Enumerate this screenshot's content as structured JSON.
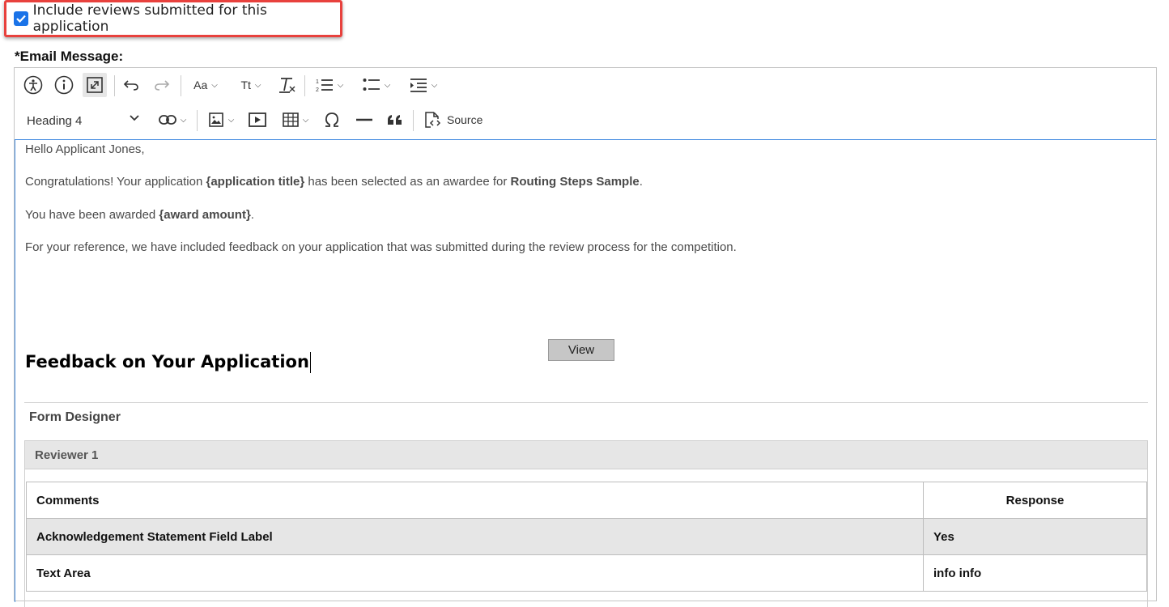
{
  "include": {
    "label": "Include reviews submitted for this application",
    "checked": true
  },
  "email_label": "*Email Message:",
  "toolbar": {
    "row1_icons": [
      "accessibility-icon",
      "info-icon",
      "maximize-icon",
      "undo-icon",
      "redo-icon",
      "font-size-icon",
      "text-case-icon",
      "clear-format-icon",
      "numbered-list-icon",
      "bulleted-list-icon",
      "indent-icon"
    ],
    "font_size_label": "Aa",
    "text_case_label": "Tt",
    "heading_value": "Heading 4",
    "source_label": "Source"
  },
  "content": {
    "greeting": "Hello Applicant Jones,",
    "congrats_pre": "Congratulations! Your application ",
    "congrats_app": "{application title}",
    "congrats_mid": " has been selected as an awardee for ",
    "congrats_comp": "Routing Steps Sample",
    "congrats_end": ".",
    "awarded_pre": "You have been awarded ",
    "awarded_amount": "{award amount}",
    "awarded_end": ".",
    "reference": "For your reference, we have included feedback on your application that was submitted during the review process for the competition.",
    "view_button": "View",
    "feedback_title": "Feedback on Your Application",
    "form_designer": "Form Designer",
    "reviewer": "Reviewer 1",
    "table": {
      "headers": [
        "Comments",
        "Response"
      ],
      "rows": [
        [
          "Acknowledgement Statement Field Label",
          "Yes"
        ],
        [
          "Text Area",
          "info info"
        ]
      ]
    }
  }
}
